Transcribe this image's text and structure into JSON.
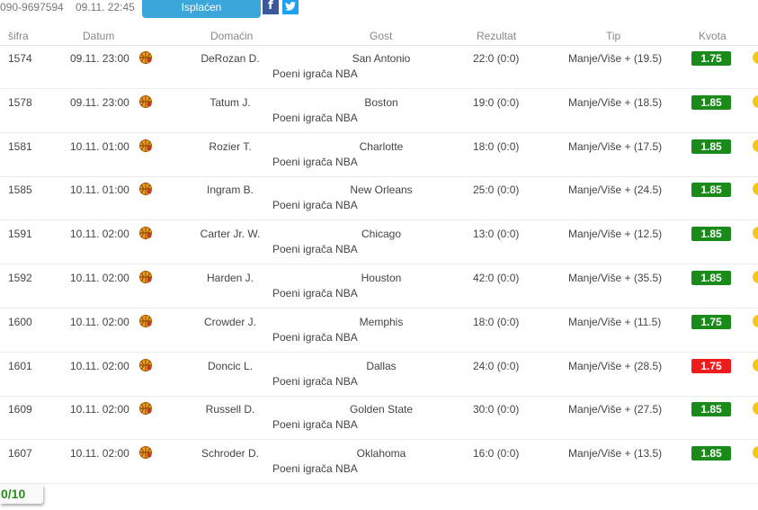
{
  "header": {
    "ticket_id": "090-9697594",
    "ticket_date": "09.11. 22:45",
    "status_label": "Isplaćen",
    "facebook_label": "f"
  },
  "columns": {
    "sifra": "šifra",
    "datum": "Datum",
    "domacin": "Domaćin",
    "gost": "Gost",
    "rezultat": "Rezultat",
    "tip": "Tip",
    "kvota": "Kvota"
  },
  "rows": [
    {
      "sifra": "1574",
      "datum": "09.11. 23:00",
      "home": "DeRozan D.",
      "away": "San Antonio",
      "league": "Poeni igrača NBA",
      "result": "22:0 (0:0)",
      "tip": "Manje/Više + (19.5)",
      "odds": "1.75",
      "odds_color": "#1a8a1a"
    },
    {
      "sifra": "1578",
      "datum": "09.11. 23:00",
      "home": "Tatum J.",
      "away": "Boston",
      "league": "Poeni igrača NBA",
      "result": "19:0 (0:0)",
      "tip": "Manje/Više + (18.5)",
      "odds": "1.85",
      "odds_color": "#1a8a1a"
    },
    {
      "sifra": "1581",
      "datum": "10.11. 01:00",
      "home": "Rozier T.",
      "away": "Charlotte",
      "league": "Poeni igrača NBA",
      "result": "18:0 (0:0)",
      "tip": "Manje/Više + (17.5)",
      "odds": "1.85",
      "odds_color": "#1a8a1a"
    },
    {
      "sifra": "1585",
      "datum": "10.11. 01:00",
      "home": "Ingram B.",
      "away": "New Orleans",
      "league": "Poeni igrača NBA",
      "result": "25:0 (0:0)",
      "tip": "Manje/Više + (24.5)",
      "odds": "1.85",
      "odds_color": "#1a8a1a"
    },
    {
      "sifra": "1591",
      "datum": "10.11. 02:00",
      "home": "Carter Jr. W.",
      "away": "Chicago",
      "league": "Poeni igrača NBA",
      "result": "13:0 (0:0)",
      "tip": "Manje/Više + (12.5)",
      "odds": "1.85",
      "odds_color": "#1a8a1a"
    },
    {
      "sifra": "1592",
      "datum": "10.11. 02:00",
      "home": "Harden J.",
      "away": "Houston",
      "league": "Poeni igrača NBA",
      "result": "42:0 (0:0)",
      "tip": "Manje/Više + (35.5)",
      "odds": "1.85",
      "odds_color": "#1a8a1a"
    },
    {
      "sifra": "1600",
      "datum": "10.11. 02:00",
      "home": "Crowder J.",
      "away": "Memphis",
      "league": "Poeni igrača NBA",
      "result": "18:0 (0:0)",
      "tip": "Manje/Više + (11.5)",
      "odds": "1.75",
      "odds_color": "#1a8a1a"
    },
    {
      "sifra": "1601",
      "datum": "10.11. 02:00",
      "home": "Doncic L.",
      "away": "Dallas",
      "league": "Poeni igrača NBA",
      "result": "24:0 (0:0)",
      "tip": "Manje/Više + (28.5)",
      "odds": "1.75",
      "odds_color": "#ee1c1c"
    },
    {
      "sifra": "1609",
      "datum": "10.11. 02:00",
      "home": "Russell D.",
      "away": "Golden State",
      "league": "Poeni igrača NBA",
      "result": "30:0 (0:0)",
      "tip": "Manje/Više + (27.5)",
      "odds": "1.85",
      "odds_color": "#1a8a1a"
    },
    {
      "sifra": "1607",
      "datum": "10.11. 02:00",
      "home": "Schroder D.",
      "away": "Oklahoma",
      "league": "Poeni igrača NBA",
      "result": "16:0 (0:0)",
      "tip": "Manje/Više + (13.5)",
      "odds": "1.85",
      "odds_color": "#1a8a1a"
    }
  ],
  "summary": {
    "score": "0/10"
  },
  "icons": {
    "sport": "basketball-icon",
    "facebook": "facebook-icon",
    "twitter": "twitter-icon",
    "status": "status-dot-icon"
  }
}
